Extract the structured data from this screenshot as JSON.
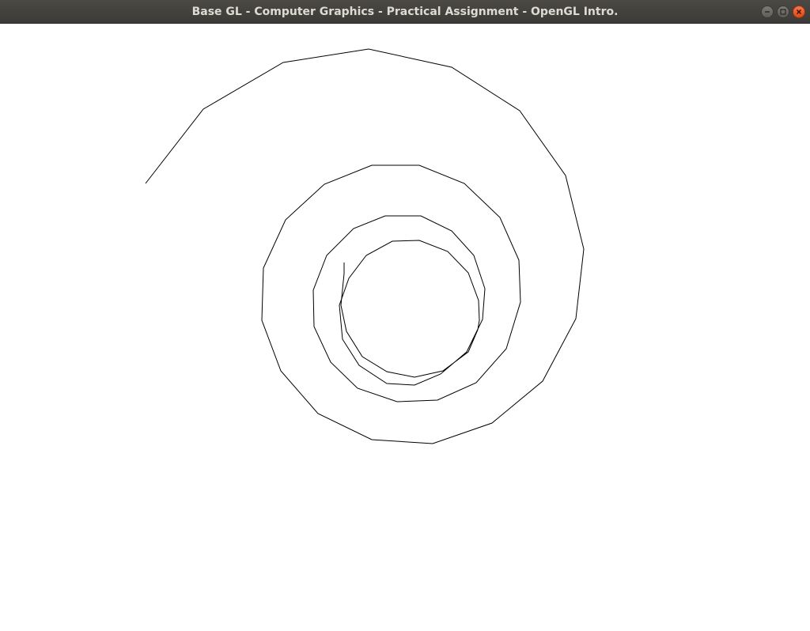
{
  "window": {
    "title": "Base GL - Computer Graphics - Practical Assignment - OpenGL Intro.",
    "controls": {
      "minimize_icon": "minimize-icon",
      "maximize_icon": "maximize-icon",
      "close_icon": "close-icon"
    }
  },
  "canvas": {
    "background": "#ffffff",
    "stroke_color": "#000000",
    "shape": "spiral polyline"
  }
}
